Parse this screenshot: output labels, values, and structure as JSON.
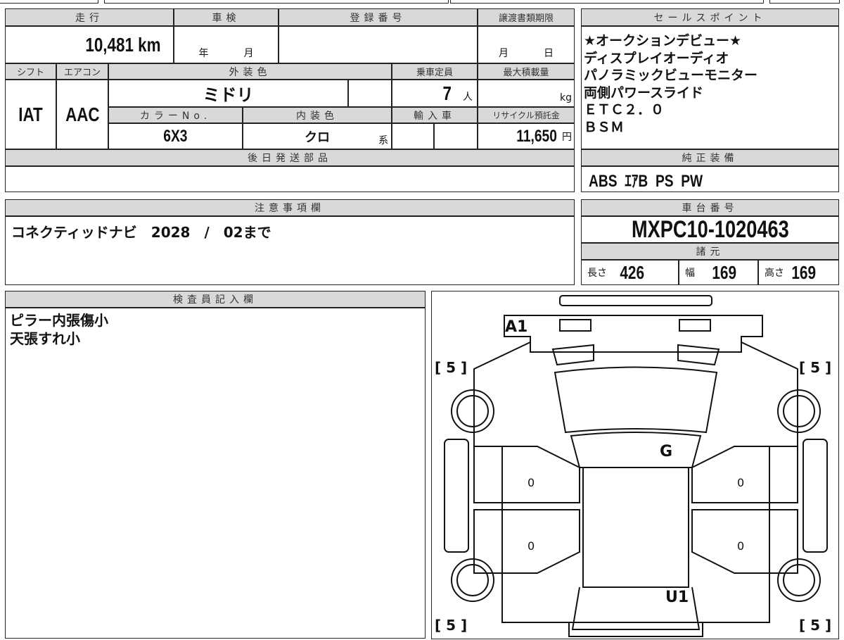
{
  "mileage": {
    "label": "走行",
    "value": "10,481",
    "unit": "km"
  },
  "inspection": {
    "label": "車検",
    "year": "年",
    "month": "月"
  },
  "registration": {
    "label": "登録番号",
    "value": ""
  },
  "transfer_deadline": {
    "label": "譲渡書類期限",
    "month": "月",
    "day": "日"
  },
  "shift": {
    "label": "シフト",
    "value": "IAT"
  },
  "aircon": {
    "label": "エアコン",
    "value": "AAC"
  },
  "exterior_color": {
    "label": "外装色",
    "value": "ミドリ"
  },
  "capacity": {
    "label": "乗車定員",
    "value": "7",
    "unit": "人"
  },
  "max_load": {
    "label": "最大積載量",
    "value": "",
    "unit": "kg"
  },
  "color_no": {
    "label": "カラーNo.",
    "value": "6X3"
  },
  "interior_color": {
    "label": "内装色",
    "value": "クロ",
    "suffix": "系"
  },
  "import": {
    "label": "輸入車"
  },
  "recycle": {
    "label": "リサイクル預託金",
    "value": "11,650",
    "unit": "円"
  },
  "later_parts": {
    "label": "後日発送部品",
    "value": ""
  },
  "sales_points": {
    "label": "セールスポイント",
    "lines": [
      "★オークションデビュー★",
      "ディスプレイオーディオ",
      "パノラミックビューモニター",
      "両側パワースライド",
      "ＥＴＣ２．０",
      "ＢＳＭ"
    ]
  },
  "standard_equipment": {
    "label": "純正装備",
    "value": "ABS  ｴｱB  PS  PW"
  },
  "notes": {
    "label": "注意事項欄",
    "value": "コネクティッドナビ　2028　/　02まで"
  },
  "chassis": {
    "label": "車台番号",
    "value": "MXPC10-1020463"
  },
  "specs": {
    "label": "諸元",
    "length_label": "長さ",
    "length": "426",
    "width_label": "幅",
    "width": "169",
    "height_label": "高さ",
    "height": "169"
  },
  "inspector": {
    "label": "検査員記入欄",
    "lines": [
      "ピラー内張傷小",
      "天張すれ小"
    ]
  },
  "diagram": {
    "marks": {
      "front": "A1",
      "roof": "G",
      "rear": "U1",
      "door_fl": "0",
      "door_rl": "0",
      "door_fr": "0",
      "door_rr": "0",
      "tire_fl": "[ 5 ]",
      "tire_fr": "[ 5 ]",
      "tire_rl": "[ 5 ]",
      "tire_rr": "[ 5 ]"
    }
  }
}
